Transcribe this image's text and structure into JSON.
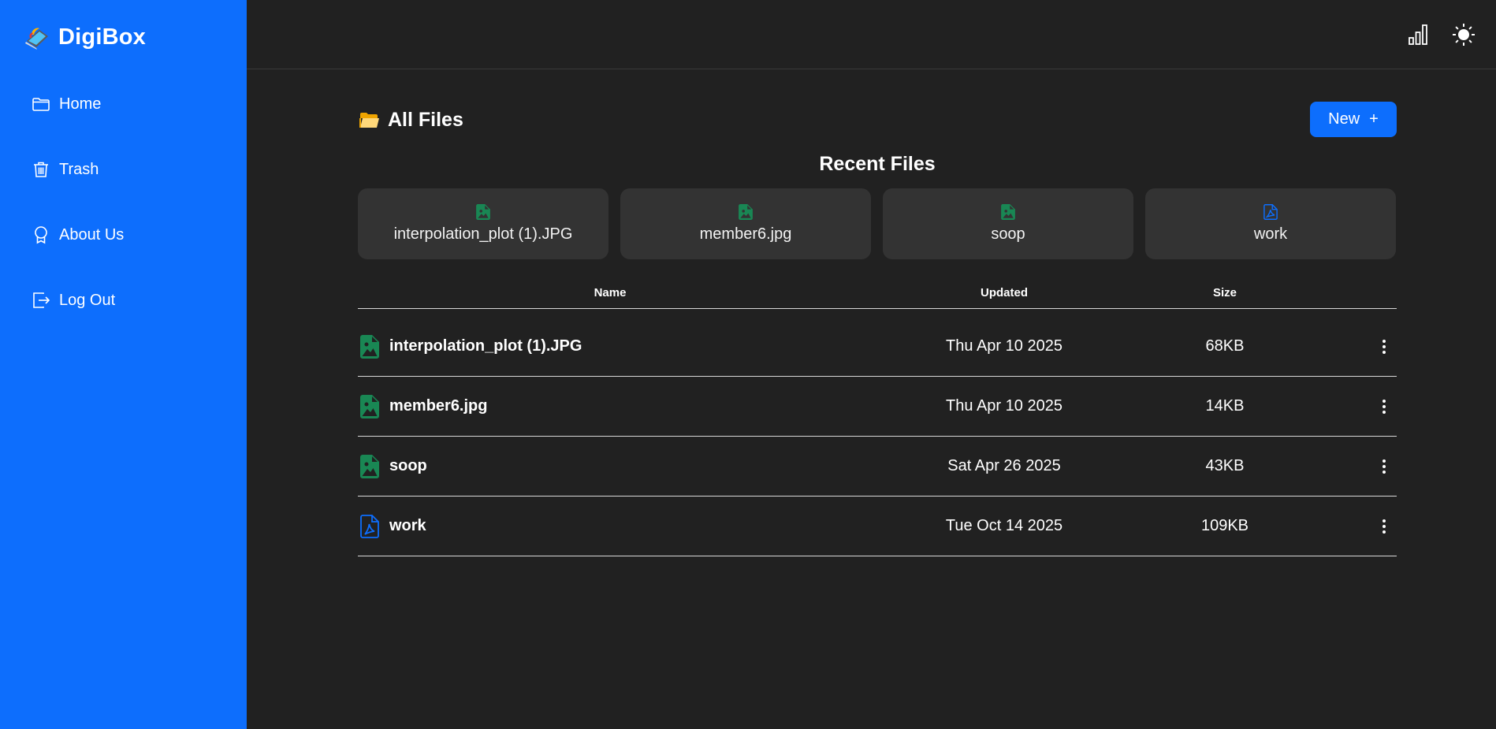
{
  "brand": {
    "name": "DigiBox",
    "logo_icon": "laptop-logo-icon"
  },
  "sidebar": {
    "items": [
      {
        "label": "Home",
        "icon": "folder-icon"
      },
      {
        "label": "Trash",
        "icon": "trash-icon"
      },
      {
        "label": "About Us",
        "icon": "award-icon"
      },
      {
        "label": "Log Out",
        "icon": "logout-icon"
      }
    ]
  },
  "topbar": {
    "stats_icon": "bar-chart-icon",
    "theme_icon": "sun-icon"
  },
  "main": {
    "title": "All Files",
    "new_button": {
      "label": "New",
      "icon": "plus-icon"
    },
    "recent_title": "Recent Files",
    "recent_files": [
      {
        "name": "interpolation_plot (1).JPG",
        "type": "image"
      },
      {
        "name": "member6.jpg",
        "type": "image"
      },
      {
        "name": "soop",
        "type": "image"
      },
      {
        "name": "work",
        "type": "pdf"
      }
    ],
    "table": {
      "headers": {
        "name": "Name",
        "updated": "Updated",
        "size": "Size"
      },
      "rows": [
        {
          "name": "interpolation_plot (1).JPG",
          "updated": "Thu Apr 10 2025",
          "size": "68KB",
          "type": "image"
        },
        {
          "name": "member6.jpg",
          "updated": "Thu Apr 10 2025",
          "size": "14KB",
          "type": "image"
        },
        {
          "name": "soop",
          "updated": "Sat Apr 26 2025",
          "size": "43KB",
          "type": "image"
        },
        {
          "name": "work",
          "updated": "Tue Oct 14 2025",
          "size": "109KB",
          "type": "pdf"
        }
      ]
    }
  },
  "colors": {
    "sidebar_bg": "#0d6efd",
    "main_bg": "#212121",
    "card_bg": "#333333",
    "image_icon": "#198754",
    "pdf_icon": "#0d6efd"
  }
}
